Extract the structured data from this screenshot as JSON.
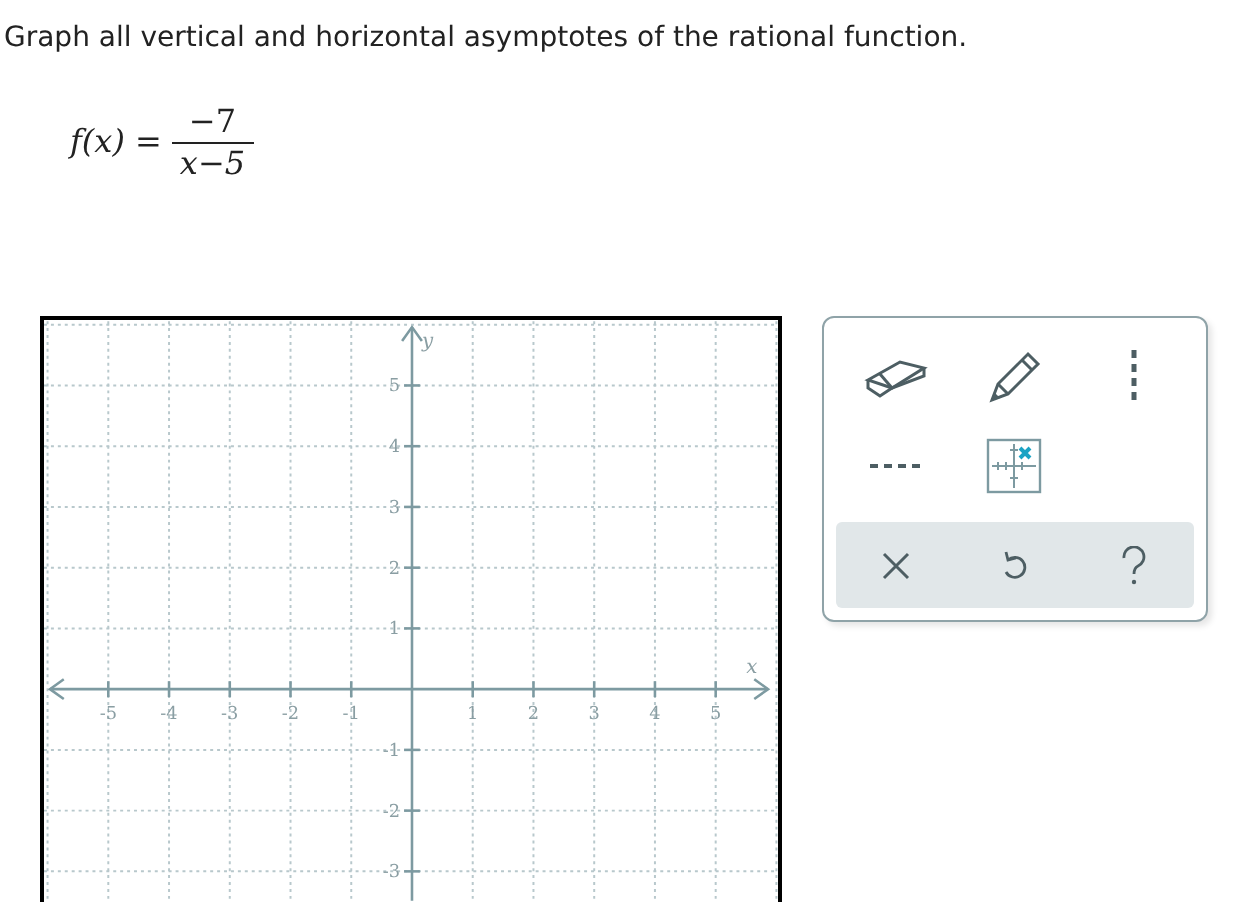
{
  "instruction": "Graph all vertical and horizontal asymptotes of the rational function.",
  "formula": {
    "lhs": "f(x) =",
    "numerator": "−7",
    "denominator": "x−5"
  },
  "graph": {
    "x_label": "x",
    "y_label": "y",
    "x_ticks": [
      "-5",
      "-4",
      "-3",
      "-2",
      "-1",
      "1",
      "2",
      "3",
      "4",
      "5"
    ],
    "y_ticks": [
      "5",
      "4",
      "3",
      "2",
      "1",
      "-1",
      "-2",
      "-3"
    ]
  },
  "tools": [
    {
      "kind": "eraser"
    },
    {
      "kind": "pencil"
    },
    {
      "kind": "vertical-dash"
    },
    {
      "kind": "horizontal-dash"
    },
    {
      "kind": "point-grid"
    }
  ],
  "actions": [
    {
      "kind": "clear"
    },
    {
      "kind": "undo"
    },
    {
      "kind": "help"
    }
  ]
}
